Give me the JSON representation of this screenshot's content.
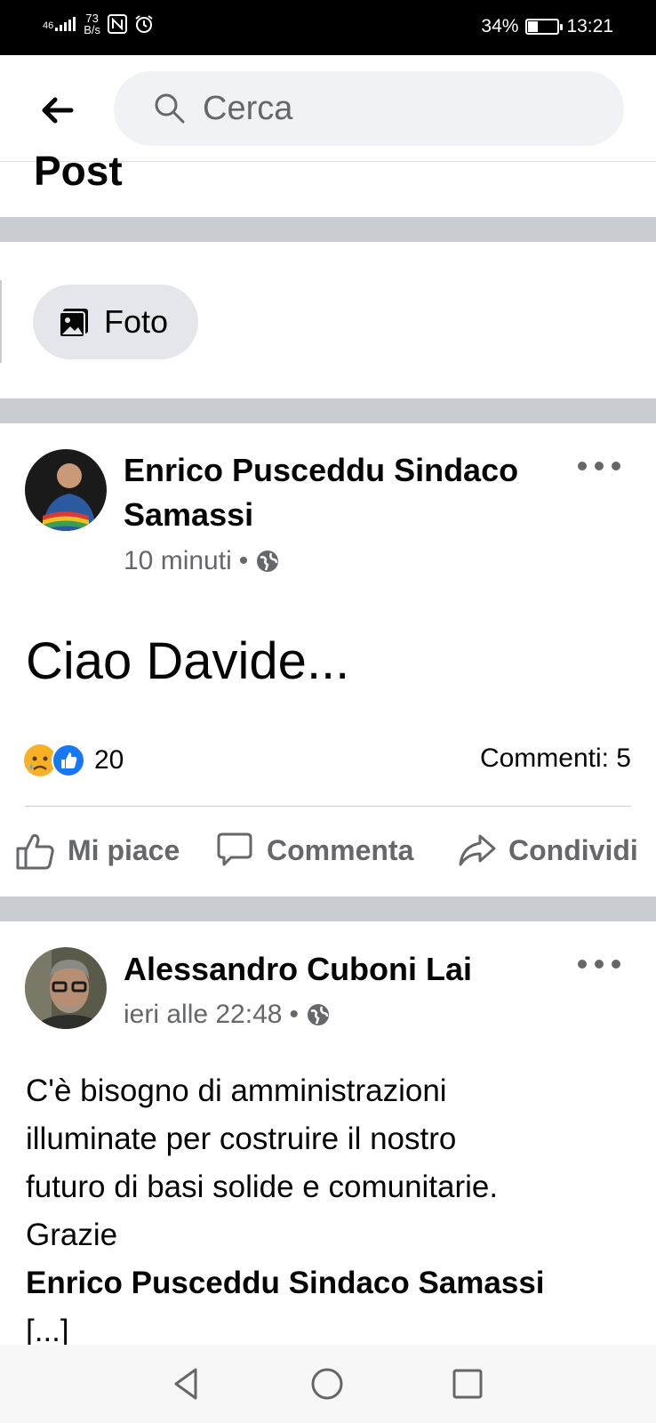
{
  "status_bar": {
    "network": "46",
    "speed_value": "73",
    "speed_unit": "B/s",
    "battery_pct": "34%",
    "battery_level": 0.34,
    "time": "13:21"
  },
  "search": {
    "placeholder": "Cerca"
  },
  "section_title": "Post",
  "filter_chip": {
    "label": "Foto"
  },
  "posts": [
    {
      "author_line1": "Enrico Pusceddu Sindaco",
      "author_line2": "Samassi",
      "time": "10 minuti",
      "text": "Ciao Davide...",
      "reaction_count": "20",
      "comments": "Commenti: 5",
      "actions": {
        "like": "Mi piace",
        "comment": "Commenta",
        "share": "Condividi"
      }
    },
    {
      "author": "Alessandro Cuboni Lai",
      "time": "ieri alle 22:48",
      "text_lines": [
        "C'è bisogno di amministrazioni",
        "illuminate per costruire il nostro",
        "futuro di basi solide e comunitarie.",
        "Grazie"
      ],
      "tagged_name": "Enrico Pusceddu Sindaco Samassi",
      "more": "[...]"
    }
  ],
  "colors": {
    "accent": "#1877f2",
    "secondary_text": "#65676b",
    "separator": "#c9ccd1"
  },
  "icons": [
    "back-arrow-icon",
    "search-icon",
    "photo-icon",
    "globe-icon",
    "more-icon",
    "sad-reaction-icon",
    "like-reaction-icon",
    "thumb-up-icon",
    "comment-icon",
    "share-icon",
    "nav-back-icon",
    "nav-home-icon",
    "nav-recents-icon"
  ]
}
